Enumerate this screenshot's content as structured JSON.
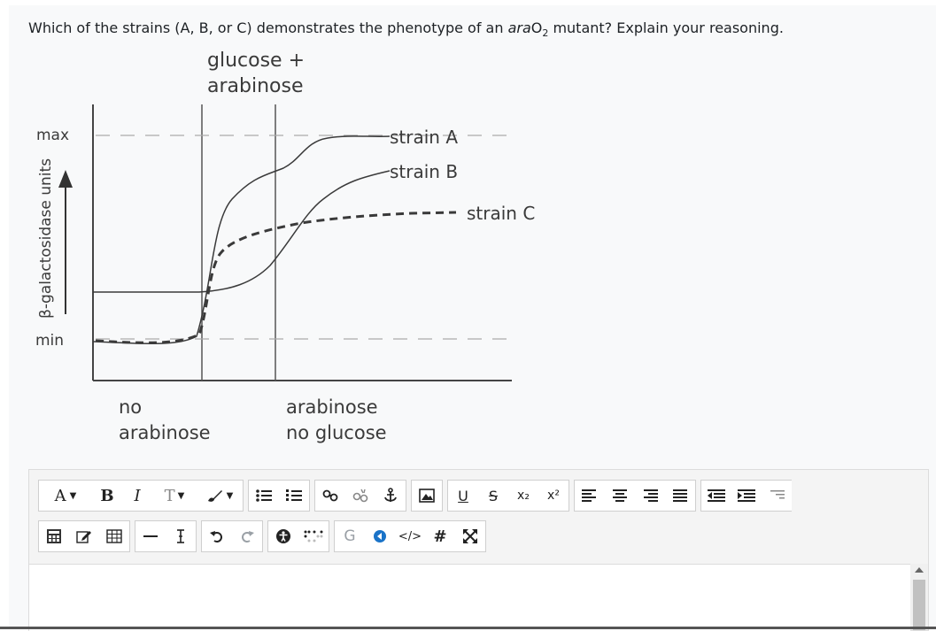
{
  "question": {
    "prefix": "Which of the strains (A, B, or C) demonstrates the phenotype of an ",
    "gene": "ara",
    "gene_suffix": "O",
    "subscript": "2",
    "suffix": " mutant? Explain your reasoning."
  },
  "figure": {
    "top_label_1": "glucose +",
    "top_label_2": "arabinose",
    "y_axis_label": "β-galactosidase units",
    "y_max": "max",
    "y_min": "min",
    "bottom_left_1": "no",
    "bottom_left_2": "arabinose",
    "bottom_right_1": "arabinose",
    "bottom_right_2": "no glucose",
    "strain_a": "strain A",
    "strain_b": "strain B",
    "strain_c": "strain C"
  },
  "toolbar": {
    "font_color": "A",
    "bold": "B",
    "italic": "I",
    "style": "T",
    "underline": "U",
    "strike": "S",
    "subscript": "x₂",
    "superscript": "x²",
    "code": "</>",
    "hash": "#",
    "g": "G"
  },
  "colors": {
    "text": "#1d2125",
    "curve": "#3a3a3a",
    "border": "#cfcfcf"
  }
}
